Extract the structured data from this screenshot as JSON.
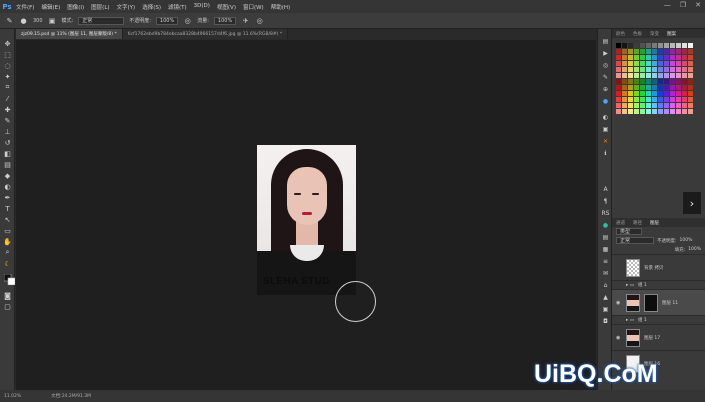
{
  "app": {
    "logo": "Ps",
    "menu": [
      "文件(F)",
      "编辑(E)",
      "图像(I)",
      "图层(L)",
      "文字(Y)",
      "选择(S)",
      "滤镜(T)",
      "3D(D)",
      "视图(V)",
      "窗口(W)",
      "帮助(H)"
    ],
    "window_controls": [
      "—",
      "❐",
      "✕"
    ]
  },
  "options": {
    "size": "300",
    "mode_label": "模式:",
    "mode": "正常",
    "opacity_label": "不透明度:",
    "opacity": "100%",
    "flow_label": "流量:",
    "flow": "100%"
  },
  "tabs": [
    {
      "label": "zjz09.15.psd @ 11% (图层 11, 图层蒙版/8) *",
      "active": true
    },
    {
      "label": "6cf1762ebd9b784ebcaa8328b4966157d4f6.jpg @ 11.6%(RGB/8#) *",
      "active": false
    }
  ],
  "status": {
    "zoom": "11.02%",
    "doc": "文档:24.2M/91.3M"
  },
  "photo": {
    "text": "SLEHA STUD"
  },
  "panels": {
    "swatch_tabs": [
      "颜色",
      "色板",
      "渐变",
      "图案"
    ],
    "layer_tabs": [
      "通道",
      "路径",
      "图层"
    ],
    "blend": "正常",
    "opacity_label": "不透明度:",
    "opacity": "100%",
    "fill_label": "填充:",
    "fill": "100%",
    "kind": "类型"
  },
  "layers": [
    {
      "name": "背景 拷贝",
      "thumb": "trans",
      "visible": false
    },
    {
      "name": "组 1",
      "thumb": "none",
      "visible": false,
      "group": true
    },
    {
      "name": "图层 11",
      "thumb": "face",
      "visible": true,
      "selected": true,
      "mask": true
    },
    {
      "name": "组 1",
      "thumb": "none",
      "visible": false,
      "group": true
    },
    {
      "name": "图层 17",
      "thumb": "face",
      "visible": true
    },
    {
      "name": "图层 16",
      "thumb": "light",
      "visible": false
    }
  ],
  "watermark": "UiBQ.CoM",
  "colors": {
    "accent": "#4aa3ff",
    "bg": "#1f1f1f",
    "panel": "#3a3a3a"
  }
}
